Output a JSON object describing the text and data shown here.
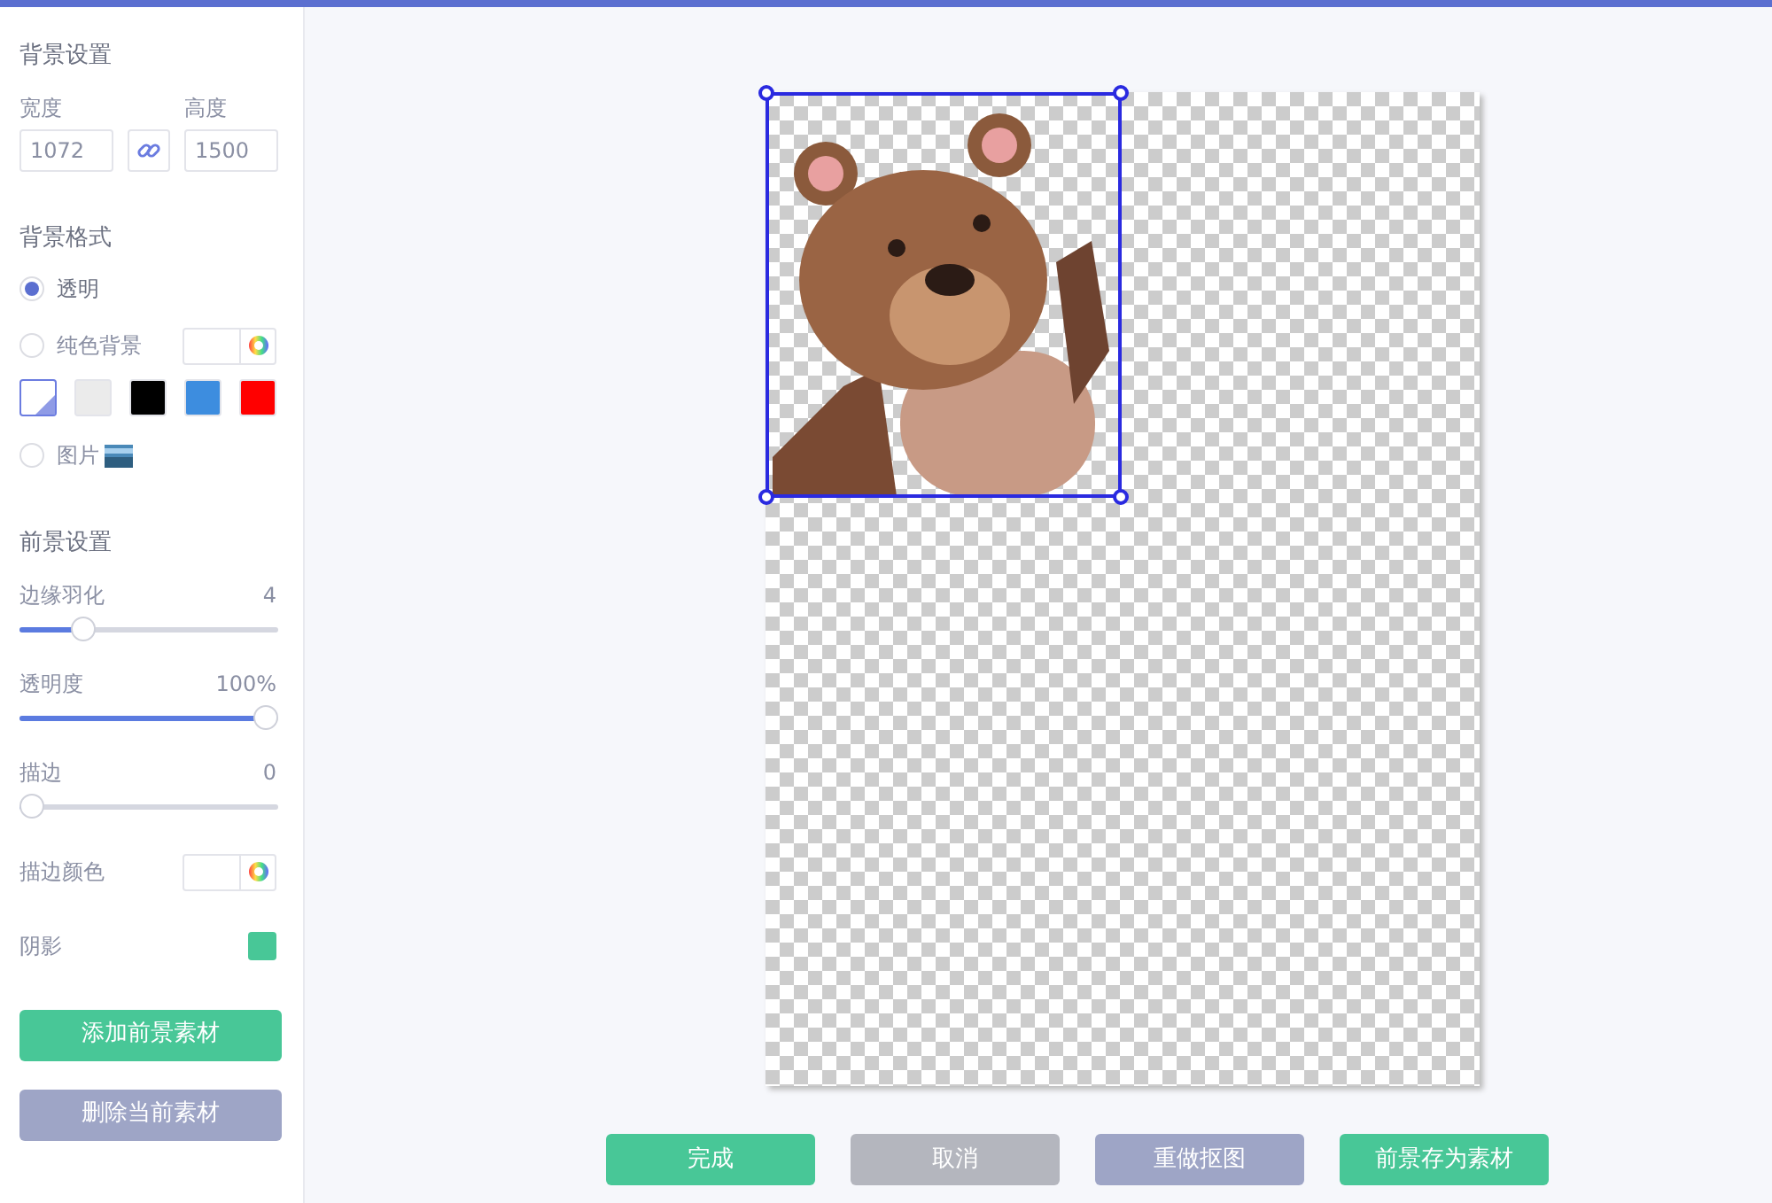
{
  "background": {
    "title": "背景设置",
    "width_label": "宽度",
    "width_value": "1072",
    "height_label": "高度",
    "height_value": "1500",
    "format_title": "背景格式",
    "options": [
      {
        "label": "透明",
        "kind": "plain",
        "selected": true
      },
      {
        "label": "纯色背景",
        "kind": "color",
        "selected": false
      },
      {
        "label": "图片",
        "kind": "image",
        "selected": false
      }
    ],
    "swatches": [
      {
        "kind": "custom",
        "color": "#ffffff",
        "selected": true
      },
      {
        "kind": "fill",
        "color": "#ebebeb",
        "selected": false
      },
      {
        "kind": "fill",
        "color": "#000000",
        "selected": false
      },
      {
        "kind": "fill",
        "color": "#3d8ddf",
        "selected": false
      },
      {
        "kind": "fill",
        "color": "#ff0000",
        "selected": false
      }
    ]
  },
  "foreground": {
    "title": "前景设置",
    "sliders": [
      {
        "label": "边缘羽化",
        "reading": "4",
        "level": 0.22
      },
      {
        "label": "透明度",
        "reading": "100%",
        "level": 1
      },
      {
        "label": "描边",
        "reading": "0",
        "level": 0
      }
    ],
    "stroke_color_label": "描边颜色",
    "shadow": {
      "label": "阴影",
      "on": true
    }
  },
  "sidebar_buttons": [
    {
      "label": "添加前景素材",
      "kind": "primary"
    },
    {
      "label": "删除当前素材",
      "kind": "secondary"
    }
  ],
  "bottom_buttons": [
    {
      "label": "完成",
      "kind": "primary"
    },
    {
      "label": "取消",
      "kind": "muted"
    },
    {
      "label": "重做抠图",
      "kind": "secondary"
    },
    {
      "label": "前景存为素材",
      "kind": "primary"
    }
  ]
}
